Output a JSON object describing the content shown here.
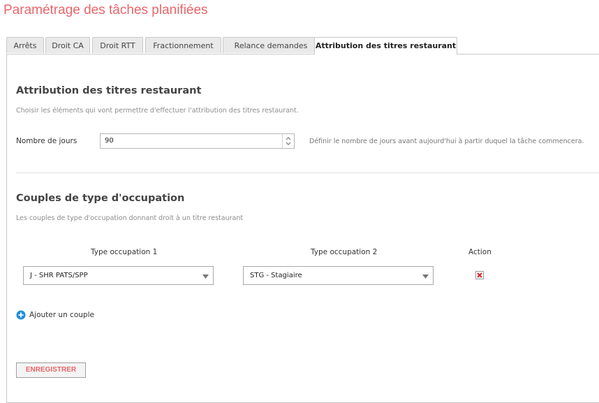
{
  "page": {
    "title": "Paramétrage des tâches planifiées"
  },
  "tabs": [
    {
      "label": "Arrêts"
    },
    {
      "label": "Droit CA"
    },
    {
      "label": "Droit RTT"
    },
    {
      "label": "Fractionnement"
    },
    {
      "label": "Relance demandes"
    },
    {
      "label": "Attribution des titres restaurant",
      "active": true
    }
  ],
  "attribution": {
    "title": "Attribution des titres restaurant",
    "description": "Choisir les éléments qui vont permettre d'effectuer l'attribution des titres restaurant.",
    "days_label": "Nombre de jours",
    "days_value": "90",
    "days_help": "Définir le nombre de jours avant aujourd'hui à partir duquel la tâche commencera."
  },
  "couples": {
    "title": "Couples de type d'occupation",
    "description": "Les couples de type d'occupation donnant droit à un titre restaurant",
    "headers": {
      "type1": "Type occupation 1",
      "type2": "Type occupation 2",
      "action": "Action"
    },
    "rows": [
      {
        "type1": "J - SHR PATS/SPP",
        "type2": "STG - Stagiaire"
      }
    ],
    "add_label": "Ajouter un couple"
  },
  "save_label": "ENREGISTRER",
  "colors": {
    "accent": "#e8666a",
    "add_icon": "#1f8ed9",
    "delete_icon": "#d9262b"
  },
  "icons": {
    "spinner": "spinner-arrows-icon",
    "dropdown": "caret-down-icon",
    "delete": "delete-x-icon",
    "add": "plus-circle-icon"
  }
}
